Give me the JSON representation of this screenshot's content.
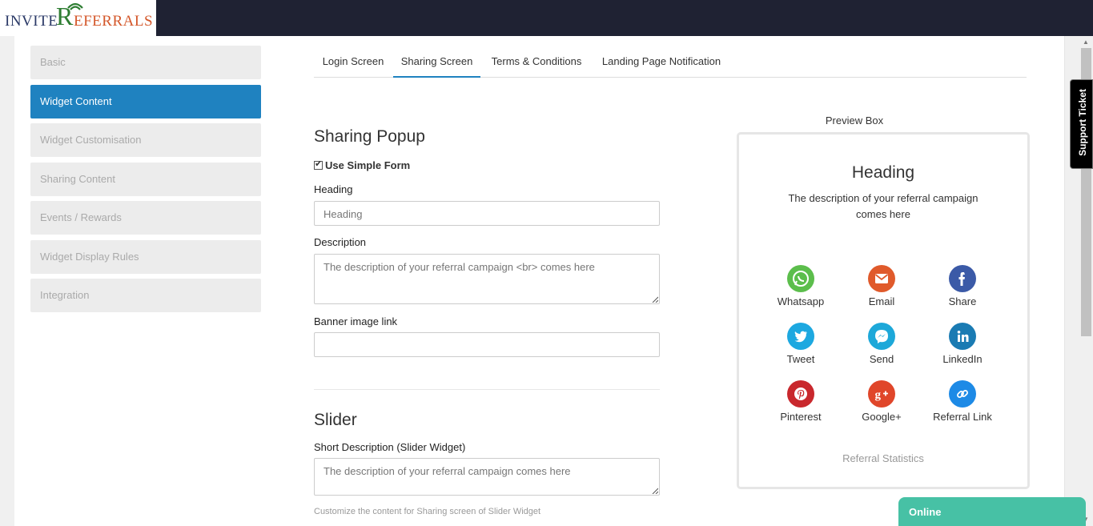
{
  "logo": {
    "part1": "INVITE",
    "part2": "R",
    "part3": "EFERRALS"
  },
  "sidebar": {
    "items": [
      {
        "label": "Basic",
        "active": false
      },
      {
        "label": "Widget Content",
        "active": true
      },
      {
        "label": "Widget Customisation",
        "active": false
      },
      {
        "label": "Sharing Content",
        "active": false
      },
      {
        "label": "Events / Rewards",
        "active": false
      },
      {
        "label": "Widget Display Rules",
        "active": false
      },
      {
        "label": "Integration",
        "active": false
      }
    ]
  },
  "tabs": [
    {
      "label": "Login Screen"
    },
    {
      "label": "Sharing Screen"
    },
    {
      "label": "Terms & Conditions"
    },
    {
      "label": "Landing Page Notification"
    }
  ],
  "form": {
    "sharing_popup_title": "Sharing Popup",
    "use_simple_form_label": "Use Simple Form",
    "use_simple_form_checked": true,
    "heading_label": "Heading",
    "heading_value": "Heading",
    "description_label": "Description",
    "description_value": "The description of your referral campaign <br> comes here",
    "banner_label": "Banner image link",
    "banner_value": "",
    "slider_title": "Slider",
    "short_desc_label": "Short Description (Slider Widget)",
    "short_desc_value": "The description of your referral campaign comes here",
    "help_text": "Customize the content for Sharing screen of Slider Widget"
  },
  "preview": {
    "label": "Preview Box",
    "heading": "Heading",
    "description_line1": "The description of your referral campaign",
    "description_line2": "comes here",
    "share_options": [
      {
        "label": "Whatsapp",
        "icon": "whatsapp-icon",
        "color": "#5cbe4c"
      },
      {
        "label": "Email",
        "icon": "email-icon",
        "color": "#e05a2b"
      },
      {
        "label": "Share",
        "icon": "facebook-icon",
        "color": "#3b5aa7"
      },
      {
        "label": "Tweet",
        "icon": "twitter-icon",
        "color": "#1da8e0"
      },
      {
        "label": "Send",
        "icon": "messenger-icon",
        "color": "#1da8d9"
      },
      {
        "label": "LinkedIn",
        "icon": "linkedin-icon",
        "color": "#1a7bb3"
      },
      {
        "label": "Pinterest",
        "icon": "pinterest-icon",
        "color": "#c9282d"
      },
      {
        "label": "Google+",
        "icon": "google-plus-icon",
        "color": "#e0462a"
      },
      {
        "label": "Referral Link",
        "icon": "link-icon",
        "color": "#1d8ae6"
      }
    ],
    "stats_label": "Referral Statistics"
  },
  "support_ticket": {
    "label": "Support Ticket"
  },
  "chat": {
    "status": "Online"
  }
}
